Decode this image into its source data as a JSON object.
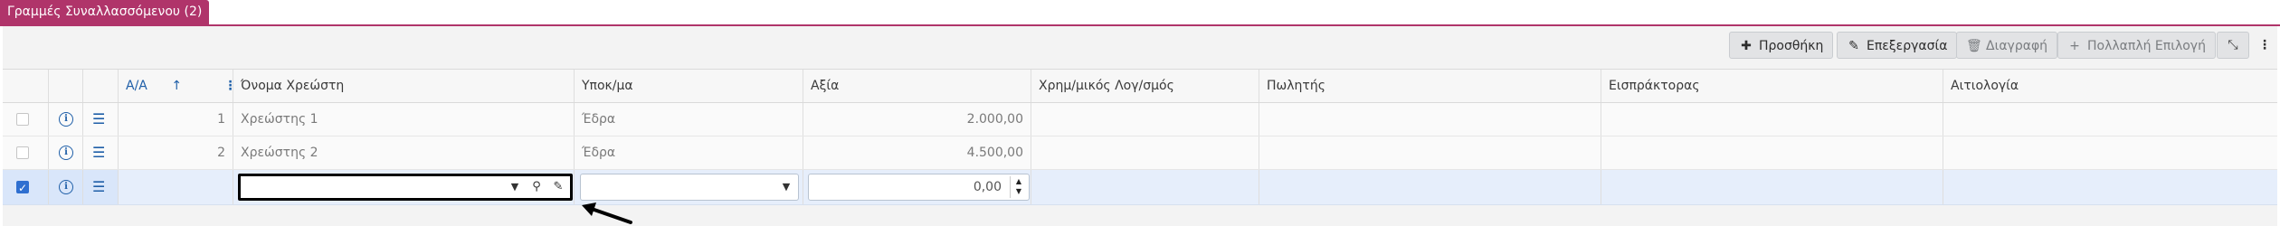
{
  "tab": {
    "label": "Γραμμές Συναλλασσόμενου (2)"
  },
  "toolbar": {
    "add_label": "Προσθήκη",
    "edit_label": "Επεξεργασία",
    "delete_label": "Διαγραφή",
    "multiselect_label": "Πολλαπλή Επιλογή"
  },
  "columns": {
    "index": "Α/Α",
    "debtor_name": "Όνομα Χρεώστη",
    "branch": "Υποκ/μα",
    "value": "Αξία",
    "financial_account": "Χρημ/μικός Λογ/σμός",
    "seller": "Πωλητής",
    "collector": "Εισπράκτορας",
    "reason": "Αιτιολογία"
  },
  "rows": [
    {
      "index": "1",
      "debtor_name": "Χρεώστης 1",
      "branch": "Έδρα",
      "value": "2.000,00"
    },
    {
      "index": "2",
      "debtor_name": "Χρεώστης 2",
      "branch": "Έδρα",
      "value": "4.500,00"
    }
  ],
  "edit_row": {
    "value": "0,00"
  }
}
